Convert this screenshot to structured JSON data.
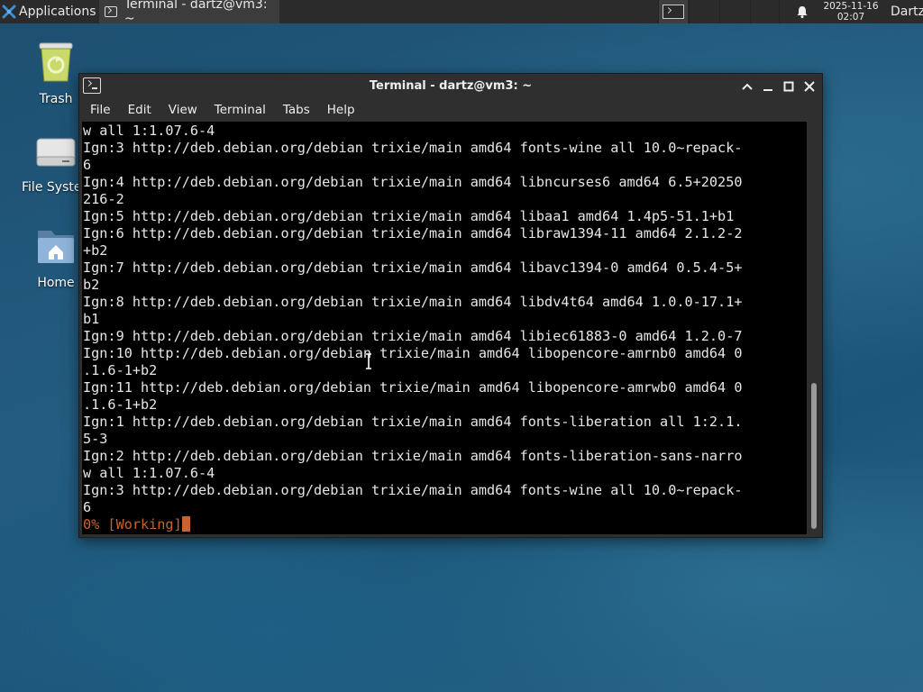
{
  "panel": {
    "applications_label": "Applications",
    "taskbar_item": "Terminal - dartz@vm3: ~",
    "date": "2025-11-16",
    "time": "02:07",
    "user": "Dartz"
  },
  "desktop": {
    "icons": [
      {
        "label": "Trash",
        "icon": "trash-icon"
      },
      {
        "label": "File System",
        "icon": "drive-icon"
      },
      {
        "label": "Home",
        "icon": "home-folder-icon"
      }
    ]
  },
  "window": {
    "title": "Terminal - dartz@vm3: ~",
    "menu": [
      "File",
      "Edit",
      "View",
      "Terminal",
      "Tabs",
      "Help"
    ]
  },
  "terminal": {
    "lines": [
      "w all 1:1.07.6-4",
      "Ign:3 http://deb.debian.org/debian trixie/main amd64 fonts-wine all 10.0~repack-",
      "6",
      "Ign:4 http://deb.debian.org/debian trixie/main amd64 libncurses6 amd64 6.5+20250",
      "216-2",
      "Ign:5 http://deb.debian.org/debian trixie/main amd64 libaa1 amd64 1.4p5-51.1+b1",
      "Ign:6 http://deb.debian.org/debian trixie/main amd64 libraw1394-11 amd64 2.1.2-2",
      "+b2",
      "Ign:7 http://deb.debian.org/debian trixie/main amd64 libavc1394-0 amd64 0.5.4-5+",
      "b2",
      "Ign:8 http://deb.debian.org/debian trixie/main amd64 libdv4t64 amd64 1.0.0-17.1+",
      "b1",
      "Ign:9 http://deb.debian.org/debian trixie/main amd64 libiec61883-0 amd64 1.2.0-7",
      "Ign:10 http://deb.debian.org/debian trixie/main amd64 libopencore-amrnb0 amd64 0",
      ".1.6-1+b2",
      "Ign:11 http://deb.debian.org/debian trixie/main amd64 libopencore-amrwb0 amd64 0",
      ".1.6-1+b2",
      "Ign:1 http://deb.debian.org/debian trixie/main amd64 fonts-liberation all 1:2.1.",
      "5-3",
      "Ign:2 http://deb.debian.org/debian trixie/main amd64 fonts-liberation-sans-narro",
      "w all 1:1.07.6-4",
      "Ign:3 http://deb.debian.org/debian trixie/main amd64 fonts-wine all 10.0~repack-",
      "6"
    ],
    "progress_line": "0% [Working]",
    "progress_color": "#c8642d"
  }
}
